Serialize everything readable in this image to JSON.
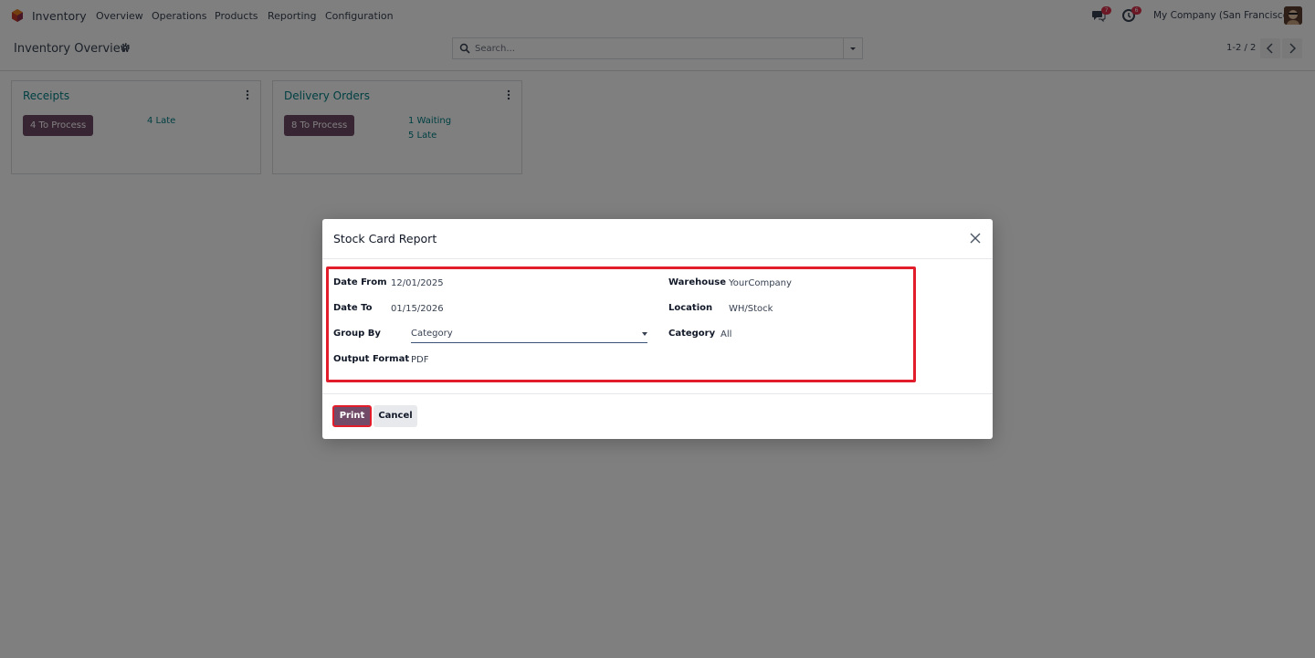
{
  "navbar": {
    "app_name": "Inventory",
    "menu": [
      "Overview",
      "Operations",
      "Products",
      "Reporting",
      "Configuration"
    ],
    "messages_badge": "7",
    "activities_badge": "6",
    "company": "My Company (San Francisco)"
  },
  "control_panel": {
    "breadcrumb": "Inventory Overview",
    "search_placeholder": "Search...",
    "pager": "1-2 / 2"
  },
  "kanban": [
    {
      "title": "Receipts",
      "button": "4 To Process",
      "links": [
        "4 Late"
      ]
    },
    {
      "title": "Delivery Orders",
      "button": "8 To Process",
      "links": [
        "1 Waiting",
        "5 Late"
      ]
    }
  ],
  "dialog": {
    "title": "Stock Card Report",
    "fields": {
      "date_from_label": "Date From",
      "date_from": "12/01/2025",
      "date_to_label": "Date To",
      "date_to": "01/15/2026",
      "group_by_label": "Group By",
      "group_by": "Category",
      "output_format_label": "Output Format",
      "output_format": "PDF",
      "warehouse_label": "Warehouse",
      "warehouse": "YourCompany",
      "location_label": "Location",
      "location": "WH/Stock",
      "category_label": "Category",
      "category": "All"
    },
    "print_label": "Print",
    "cancel_label": "Cancel"
  },
  "colors": {
    "brand": "#714b67",
    "link": "#017e84",
    "highlight": "#e11d2b"
  }
}
